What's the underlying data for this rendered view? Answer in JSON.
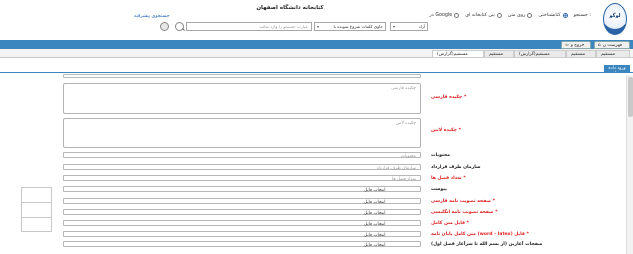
{
  "header": {
    "site_title": "کتابخانه دانشگاه اصفهان",
    "logo_text": "لوگو",
    "search_label": "جستجو :",
    "radio_options": [
      {
        "label": "کتابشناختی",
        "checked": true
      },
      {
        "label": "روی متن",
        "checked": false
      },
      {
        "label": "بین کتابخانه ای",
        "checked": false
      },
      {
        "label": "در Google",
        "checked": false
      }
    ],
    "advanced_search": "جستجوی پیشرفته",
    "field_select": "آزاد",
    "condition_select": "حاوی کلمات شروع شونده با",
    "search_placeholder": "عبارت جستجو را وارد نمائید"
  },
  "tabs": {
    "list_tab": "فهرست ن",
    "exit_tab": "خروج و",
    "subtabs": [
      "مستقیم",
      "مستقیم",
      "مستقیم",
      "مستقیم(گزارش)",
      "مستقیم(گزارش)"
    ]
  },
  "section": {
    "tab_label": "ورود داده ها"
  },
  "form": {
    "fields": [
      {
        "label": "* چکیده فارسی",
        "required": true,
        "type": "textarea",
        "placeholder": "چکیده فارسی"
      },
      {
        "label": "* چکیده لاتین",
        "required": true,
        "type": "textarea",
        "placeholder": "چکیده لاتین"
      },
      {
        "label": "محتویات",
        "required": false,
        "type": "input",
        "placeholder": "محتویات"
      },
      {
        "label": "سازمان طرف قرارداد",
        "required": false,
        "type": "input",
        "placeholder": "سازمان طرف قرارداد"
      },
      {
        "label": "* تعداد فصل ها",
        "required": true,
        "type": "input",
        "placeholder": "تعداد فصل ها"
      },
      {
        "label": "پیوست",
        "required": false,
        "type": "file",
        "button": "انتخاب فایل"
      },
      {
        "label": "* صفحه تصویب نامه فارسی",
        "required": true,
        "type": "file",
        "button": "انتخاب فایل"
      },
      {
        "label": "* صفحه تصویب نامه انگلیسی",
        "required": true,
        "type": "file",
        "button": "انتخاب فایل"
      },
      {
        "label": "* فایل متن کامل",
        "required": true,
        "type": "file",
        "button": "انتخاب فایل"
      },
      {
        "label": "* فایل (word - latex) متن کامل پایان نامه",
        "required": true,
        "type": "file",
        "button": "انتخاب فایل"
      },
      {
        "label": "صفحات آغازین (از بسم الله تا سرآغاز فصل اول)",
        "required": false,
        "type": "file",
        "button": "انتخاب فایل"
      }
    ]
  }
}
